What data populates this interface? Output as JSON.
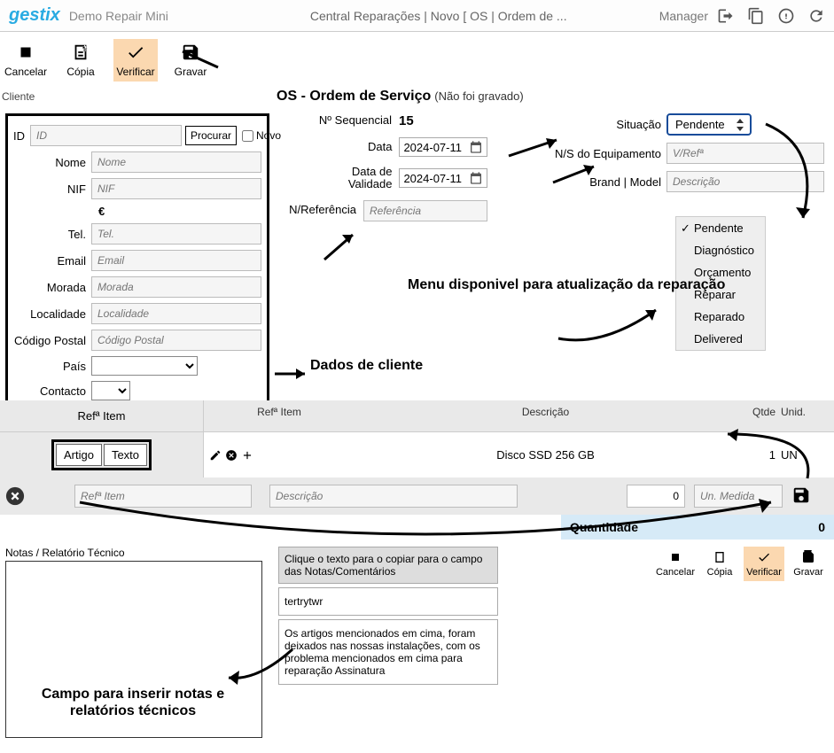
{
  "topbar": {
    "logo": "gestix",
    "title": "Demo Repair Mini",
    "crumb": "Central Reparações | Novo [ OS | Ordem de ...",
    "user": "Manager"
  },
  "toolbar": {
    "cancelar": "Cancelar",
    "copia": "Cópia",
    "verificar": "Verificar",
    "gravar": "Gravar"
  },
  "section": {
    "cliente": "Cliente",
    "os_title": "OS - Ordem de Serviço",
    "os_subtitle": "(Não foi gravado)"
  },
  "client": {
    "id_label": "ID",
    "id_placeholder": "ID",
    "procurar": "Procurar",
    "novo": "Novo",
    "nome_label": "Nome",
    "nome_placeholder": "Nome",
    "nif_label": "NIF",
    "nif_placeholder": "NIF",
    "currency": "€",
    "tel_label": "Tel.",
    "tel_placeholder": "Tel.",
    "email_label": "Email",
    "email_placeholder": "Email",
    "morada_label": "Morada",
    "morada_placeholder": "Morada",
    "localidade_label": "Localidade",
    "localidade_placeholder": "Localidade",
    "codigo_label": "Código Postal",
    "codigo_placeholder": "Código Postal",
    "pais_label": "País",
    "contacto_label": "Contacto"
  },
  "order": {
    "seq_label": "Nº Sequencial",
    "seq_value": "15",
    "data_label": "Data",
    "data_value": "2024-07-11",
    "validade_label": "Data de Validade",
    "validade_value": "2024-07-11",
    "ref_label": "N/Referência",
    "ref_placeholder": "Referência"
  },
  "right": {
    "situacao_label": "Situação",
    "situacao_value": "Pendente",
    "ns_label": "N/S do Equipamento",
    "ns_placeholder": "V/Refª",
    "brand_label": "Brand | Model",
    "brand_placeholder": "Descrição"
  },
  "status_menu": [
    "Pendente",
    "Diagnóstico",
    "Orçamento",
    "Reparar",
    "Reparado",
    "Delivered"
  ],
  "items": {
    "head_left": "Refª Item",
    "col_ref": "Refª Item",
    "col_desc": "Descrição",
    "col_qty": "Qtde",
    "col_unid": "Unid.",
    "mode_artigo": "Artigo",
    "mode_texto": "Texto",
    "row": {
      "ref": "",
      "desc": "Disco SSD 256 GB",
      "qty": "1",
      "unid": "UN"
    },
    "input_ref_placeholder": "Refª Item",
    "input_desc_placeholder": "Descrição",
    "input_qty_value": "0",
    "input_unid_placeholder": "Un. Medida",
    "total_label": "Quantidade",
    "total_value": "0"
  },
  "notes": {
    "label": "Notas / Relatório Técnico",
    "template_head": "Clique o texto para o copiar para o campo das Notas/Comentários",
    "template1": "tertrytwr",
    "template2": "Os artigos mencionados em cima, foram deixados nas nossas instalações, com os problema mencionados em cima para reparação Assinatura"
  },
  "bottom_toolbar": {
    "cancelar": "Cancelar",
    "copia": "Cópia",
    "verificar": "Verificar",
    "gravar": "Gravar"
  },
  "annotations": {
    "dados_cliente": "Dados de cliente",
    "menu_disponivel": "Menu disponivel para atualização da reparação",
    "notas_anno": "Campo para inserir notas e relatórios técnicos"
  }
}
